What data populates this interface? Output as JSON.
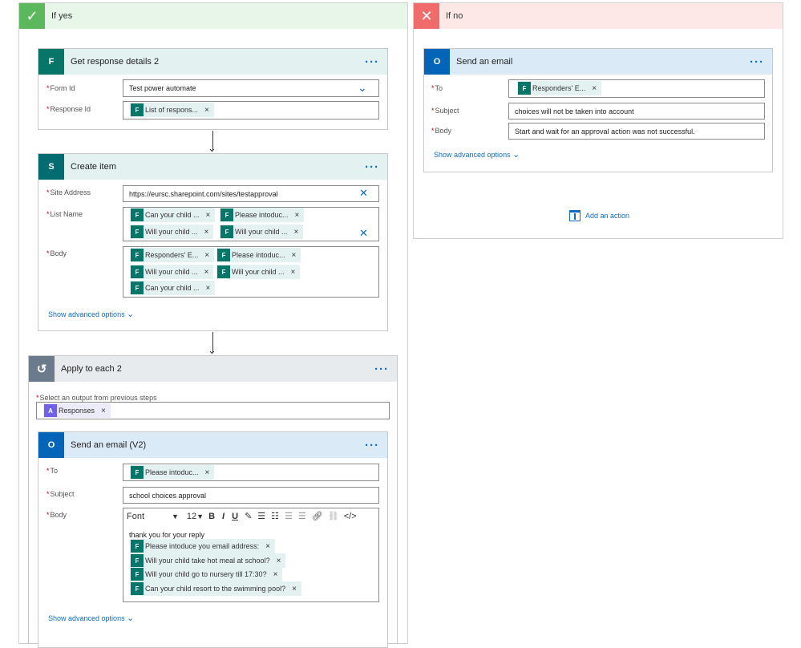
{
  "yes_branch": {
    "label": "If yes",
    "color": "#5cb85c",
    "bg": "#e8f5e9"
  },
  "no_branch": {
    "label": "If no",
    "color": "#f06c6c",
    "bg": "#fde7e7",
    "add_action": "Add an action"
  },
  "get_response": {
    "title": "Get response details 2",
    "form_id_label": "Form Id",
    "form_id_value": "Test power automate",
    "response_id_label": "Response Id",
    "response_id_token": "List of respons..."
  },
  "create_item": {
    "title": "Create item",
    "site_label": "Site Address",
    "site_value": "https://eursc.sharepoint.com/sites/testapproval",
    "list_label": "List Name",
    "list_tokens": [
      "Can your child ...",
      "Please intoduc...",
      "Will your child ...",
      "Will your child ..."
    ],
    "body_label": "Body",
    "body_tokens": [
      "Responders' E...",
      "Please intoduc...",
      "Will your child ...",
      "Will your child ...",
      "Can your child ..."
    ],
    "advanced": "Show advanced options"
  },
  "apply_each": {
    "title": "Apply to each 2",
    "select_label": "Select an output from previous steps",
    "token": "Responses"
  },
  "send_v2": {
    "title": "Send an email (V2)",
    "to_label": "To",
    "to_token": "Please intoduc...",
    "subject_label": "Subject",
    "subject_value": "school choices approval",
    "body_label": "Body",
    "font": "Font",
    "font_size": "12",
    "body_text": "thank you for your reply",
    "body_tokens": [
      "Please intoduce you email address:",
      "Will your child take hot meal at school?",
      "Will your child go to nursery till 17:30?",
      "Can your child resort to the swimming pool?"
    ],
    "advanced": "Show advanced options"
  },
  "send_no": {
    "title": "Send an email",
    "to_label": "To",
    "to_token": "Responders' E...",
    "subject_label": "Subject",
    "subject_value": "choices will not be taken into account",
    "body_label": "Body",
    "body_value": "Start and wait for an approval action was not successful.",
    "advanced": "Show advanced options"
  },
  "colors": {
    "forms_green": "#077568",
    "sharepoint_teal": "#036c70",
    "outlook_blue": "#0364b8",
    "forms_head_bg": "#e3f1f0",
    "outlook_head_bg": "#dbeaf7",
    "loop_head_bg": "#e8ebee",
    "loop_icon_bg": "#6b7b8c",
    "link_blue": "#0f6cbd"
  }
}
